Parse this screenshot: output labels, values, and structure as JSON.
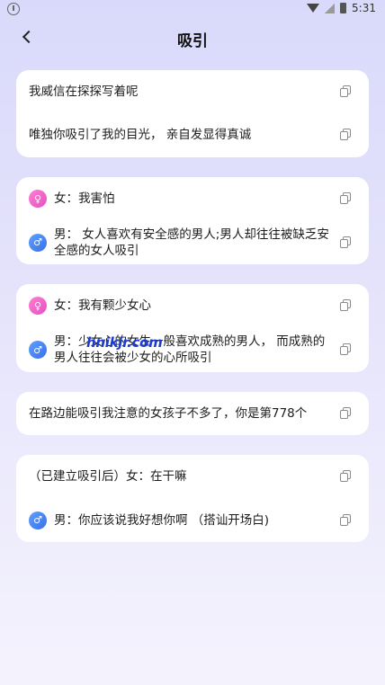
{
  "status": {
    "time": "5:31"
  },
  "header": {
    "title": "吸引"
  },
  "cards": [
    {
      "rows": [
        {
          "text": "我威信在探探写着呢"
        },
        {
          "text": "唯独你吸引了我的目光， 亲自发显得真诚"
        }
      ]
    },
    {
      "rows": [
        {
          "gender": "female",
          "text": "女：我害怕"
        },
        {
          "gender": "male",
          "text": "男： 女人喜欢有安全感的男人;男人却往往被缺乏安全感的女人吸引"
        }
      ]
    },
    {
      "rows": [
        {
          "gender": "female",
          "text": "女：我有颗少女心"
        },
        {
          "gender": "male",
          "text": "男：少女心的女生一般喜欢成熟的男人， 而成熟的男人往往会被少女的心所吸引"
        }
      ]
    },
    {
      "rows": [
        {
          "text": "在路边能吸引我注意的女孩子不多了，你是第778个"
        }
      ]
    },
    {
      "rows": [
        {
          "text": "（已建立吸引后）女：在干嘛"
        },
        {
          "gender": "male",
          "text": "男：你应该说我好想你啊 （搭讪开场白)"
        }
      ]
    }
  ],
  "icons": {
    "female": "female-symbol-icon",
    "male": "male-symbol-icon",
    "copy": "copy-icon",
    "back": "back-arrow-icon"
  },
  "colors": {
    "female_accent": "#e64fc2",
    "male_accent": "#3a6fe8"
  },
  "watermark": "hnikjr.com"
}
